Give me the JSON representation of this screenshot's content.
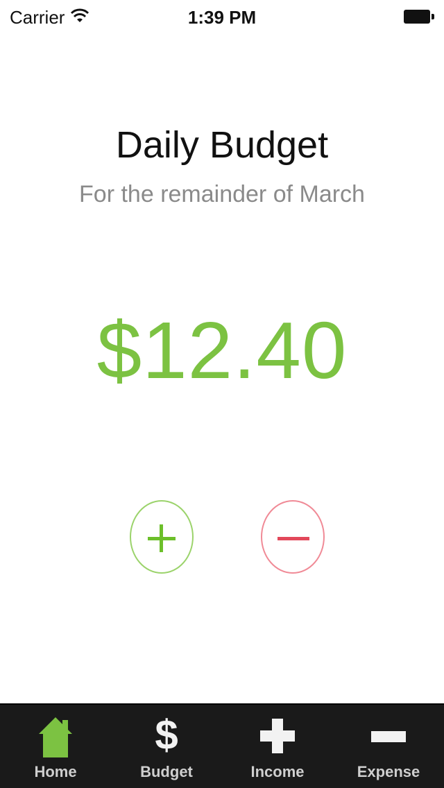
{
  "status_bar": {
    "carrier": "Carrier",
    "time": "1:39 PM"
  },
  "budget": {
    "title": "Daily Budget",
    "subtitle": "For the remainder of March",
    "amount": "$12.40"
  },
  "colors": {
    "accent_green": "#7cc242",
    "accent_red": "#e2485a",
    "tab_bar_bg": "#1a1a1a"
  },
  "tabs": [
    {
      "label": "Home",
      "icon": "home-icon"
    },
    {
      "label": "Budget",
      "icon": "dollar-icon"
    },
    {
      "label": "Income",
      "icon": "plus-icon"
    },
    {
      "label": "Expense",
      "icon": "minus-icon"
    }
  ],
  "buttons": {
    "dollar_symbol": "$"
  }
}
